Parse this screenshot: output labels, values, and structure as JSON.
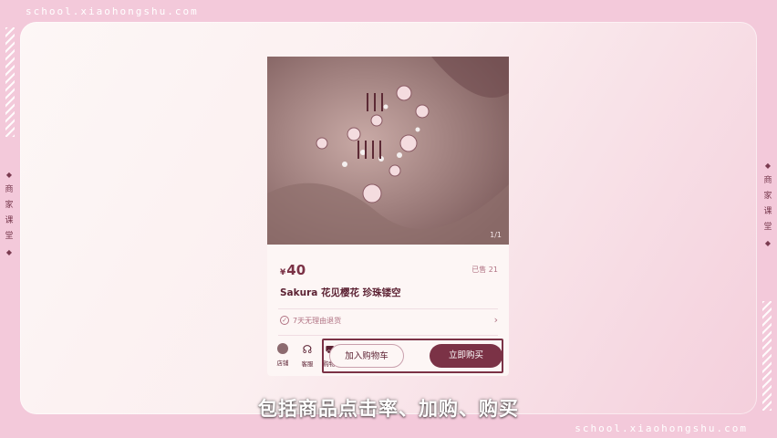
{
  "brand": {
    "url_top": "school.xiaohongshu.com",
    "url_bottom": "school.xiaohongshu.com",
    "side_label_left": [
      "商",
      "家",
      "课",
      "堂"
    ],
    "side_label_right": [
      "商",
      "家",
      "课",
      "堂"
    ]
  },
  "product": {
    "image_alt": "Sakura 花见樱花 珍珠镂空 商品图片",
    "image_watermark": "1/1",
    "currency": "¥",
    "price": "40",
    "sold_text": "已售 21",
    "title": "Sakura 花见樱花 珍珠镂空",
    "return_policy": "7天无理由退货"
  },
  "action_bar": {
    "store_label": "店铺",
    "service_label": "客服",
    "cart_label": "购物车",
    "add_to_cart_label": "加入购物车",
    "buy_now_label": "立即购买"
  },
  "subtitle": "包括商品点击率、加购、购买",
  "colors": {
    "accent": "#7b3246",
    "background": "#f3c9da"
  }
}
